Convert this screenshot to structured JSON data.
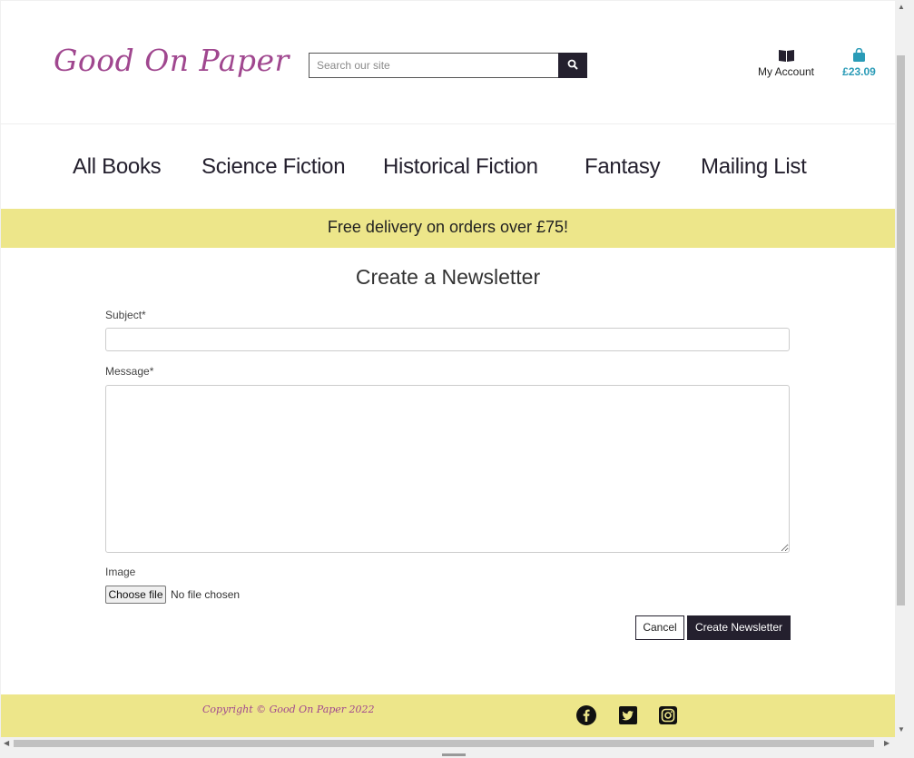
{
  "header": {
    "logo": "Good On Paper",
    "search_placeholder": "Search our site",
    "account_label": "My Account",
    "bag_total": "£23.09"
  },
  "nav": {
    "items": [
      "All Books",
      "Science Fiction",
      "Historical Fiction",
      "Fantasy",
      "Mailing List"
    ]
  },
  "banner": "Free delivery on orders over £75!",
  "form": {
    "title": "Create a Newsletter",
    "subject_label": "Subject*",
    "message_label": "Message*",
    "image_label": "Image",
    "file_button": "Choose file",
    "file_status": "No file chosen",
    "cancel": "Cancel",
    "submit": "Create Newsletter"
  },
  "footer": {
    "copyright": "Copyright © Good On Paper 2022",
    "social": [
      "facebook-icon",
      "twitter-icon",
      "instagram-icon"
    ]
  },
  "colors": {
    "brand": "#a0478f",
    "dark": "#24202e",
    "accent_banner": "#ede68a",
    "bag": "#2a9bb7"
  }
}
